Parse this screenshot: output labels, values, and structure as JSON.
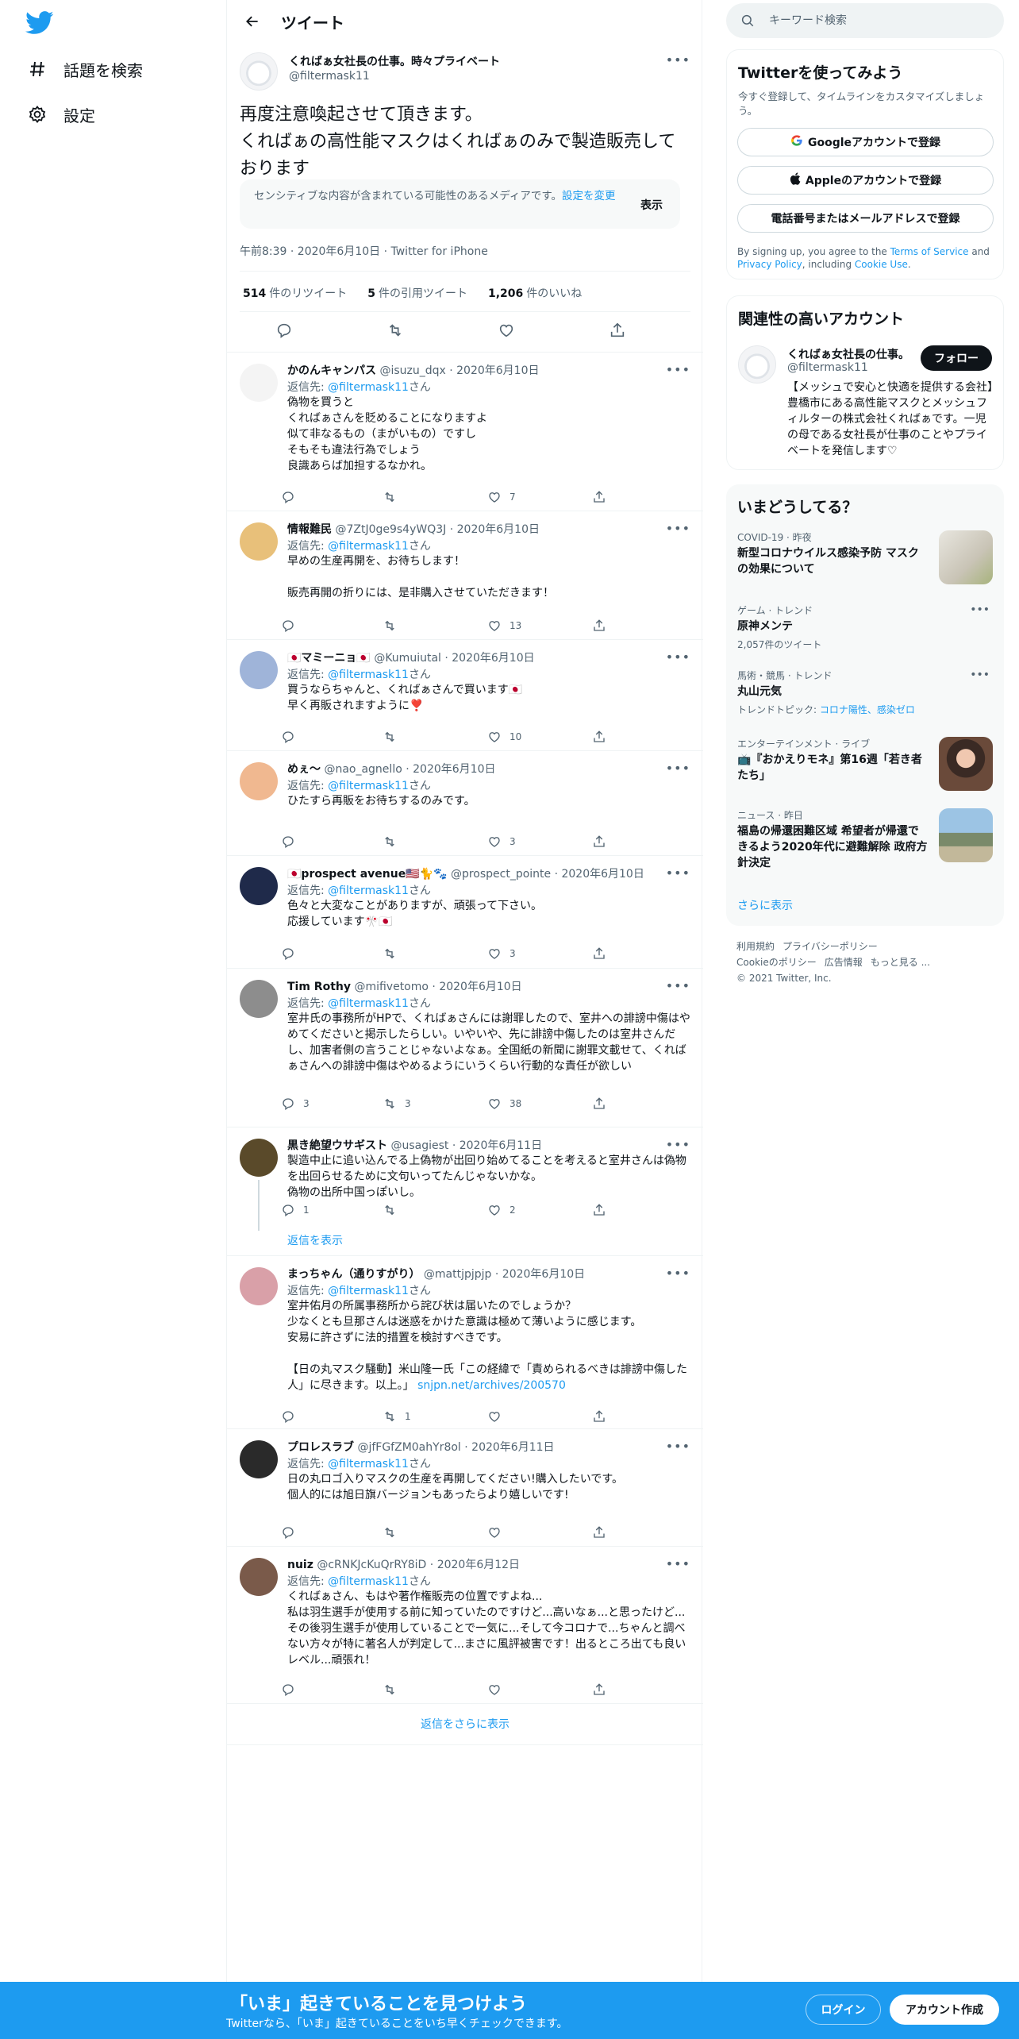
{
  "nav": {
    "explore": "話題を検索",
    "settings": "設定"
  },
  "header": {
    "title": "ツイート"
  },
  "tweet": {
    "name": "くればぁ女社長の仕事。時々プライベート",
    "handle": "@filtermask11",
    "text": "再度注意喚起させて頂きます。\nくればぁの高性能マスクはくればぁのみで製造販売しております",
    "sensitive_text": "センシティブな内容が含まれている可能性のあるメディアです。",
    "sensitive_link": "設定を変更",
    "sensitive_show": "表示",
    "meta": "午前8:39 · 2020年6月10日 · Twitter for iPhone",
    "retweets_count": "514",
    "retweets_label": "件のリツイート",
    "quotes_count": "5",
    "quotes_label": "件の引用ツイート",
    "likes_count": "1,206",
    "likes_label": "件のいいね"
  },
  "reply_prefix": "返信先: ",
  "reply_to": "@filtermask11",
  "reply_suffix": "さん",
  "replies": [
    {
      "name": "かのんキャンパス",
      "handle": "@isuzu_dqx",
      "date": "· 2020年6月10日",
      "text": "偽物を買うと\nくればぁさんを貶めることになりますよ\n似て非なるもの（まがいもの）ですし\nそもそも違法行為でしょう\n良識あらば加担するなかれ。",
      "replies": "",
      "retweets": "",
      "likes": "7",
      "color": "#f4f4f4"
    },
    {
      "name": "情報難民",
      "handle": "@7ZtJ0ge9s4yWQ3J",
      "date": "· 2020年6月10日",
      "text": "早めの生産再開を、お待ちします！\n\n販売再開の折りには、是非購入させていただきます！",
      "replies": "",
      "retweets": "",
      "likes": "13",
      "color": "#e8c07a"
    },
    {
      "name": "🇯🇵マミーニョ🇯🇵",
      "handle": "@Kumuiutal",
      "date": "· 2020年6月10日",
      "text": "買うならちゃんと、くればぁさんで買います🇯🇵\n早く再販されますように❣️",
      "replies": "",
      "retweets": "",
      "likes": "10",
      "color": "#9fb4d9"
    },
    {
      "name": "めぇ〜",
      "handle": "@nao_agnello",
      "date": "· 2020年6月10日",
      "text": "ひたすら再販をお待ちするのみです。",
      "replies": "",
      "retweets": "",
      "likes": "3",
      "color": "#f0b890"
    },
    {
      "name": "🇯🇵prospect avenue🇺🇸🐈🐾",
      "handle": "@prospect_pointe",
      "date": "· 2020年6月10日",
      "text": "色々と大変なことがありますが、頑張って下さい。\n応援しています🎌🇯🇵",
      "replies": "",
      "retweets": "",
      "likes": "3",
      "color": "#1f2a4a"
    },
    {
      "name": "Tim Rothy",
      "handle": "@mifivetomo",
      "date": "· 2020年6月10日",
      "text": "室井氏の事務所がHPで、くればぁさんには謝罪したので、室井への誹謗中傷はやめてくださいと掲示したらしい。いやいや、先に誹謗中傷したのは室井さんだし、加害者側の言うことじゃないよなぁ。全国紙の新聞に謝罪文載せて、くればぁさんへの誹謗中傷はやめるようにいうくらい行動的な責任が欲しい",
      "replies": "3",
      "retweets": "3",
      "likes": "38",
      "color": "#8d8d8d"
    },
    {
      "name": "黒き絶望ウサギスト",
      "handle": "@usagiest",
      "date": "· 2020年6月11日",
      "text": "製造中止に追い込んでる上偽物が出回り始めてることを考えると室井さんは偽物を出回らせるために文句いってたんじゃないかな。\n偽物の出所中国っぽいし。",
      "replies": "1",
      "retweets": "",
      "likes": "2",
      "color": "#5a4a2a"
    },
    {
      "name": "まっちゃん（通りすがり）",
      "handle": "@mattjpjpjp",
      "date": "· 2020年6月10日",
      "text": "室井佑月の所属事務所から詫び状は届いたのでしょうか？\n少なくとも旦那さんは迷惑をかけた意識は極めて薄いように感じます。\n安易に許さずに法的措置を検討すべきです。\n\n【日の丸マスク騒動】米山隆一氏「この経緯で「責められるべきは誹謗中傷した人」に尽きます。以上。」",
      "link": "snjpn.net/archives/200570",
      "replies": "",
      "retweets": "1",
      "likes": "",
      "color": "#d9a0a8"
    },
    {
      "name": "プロレスラブ",
      "handle": "@jfFGfZM0ahYr8ol",
      "date": "· 2020年6月11日",
      "text": "日の丸ロゴ入りマスクの生産を再開してください!購入したいです。\n個人的には旭日旗バージョンもあったらより嬉しいです!",
      "replies": "",
      "retweets": "",
      "likes": "",
      "color": "#2a2a2a"
    },
    {
      "name": "nuiz",
      "handle": "@cRNKJcKuQrRY8iD",
      "date": "· 2020年6月12日",
      "text": "くればぁさん、もはや著作権販売の位置ですよね...\n私は羽生選手が使用する前に知っていたのですけど...高いなぁ...と思ったけど...その後羽生選手が使用していることで一気に...そして今コロナで...ちゃんと調べない方々が特に著名人が判定して...まさに風評被害です！出るところ出ても良いレベル...頑張れ！",
      "replies": "",
      "retweets": "",
      "likes": "",
      "color": "#7a5a4a"
    }
  ],
  "show_replies": "返信を表示",
  "more_replies": "返信をさらに表示",
  "sidebar": {
    "search_placeholder": "キーワード検索",
    "signup": {
      "title": "Twitterを使ってみよう",
      "subtitle": "今すぐ登録して、タイムラインをカスタマイズしましょう。",
      "google": "Googleアカウントで登録",
      "apple": "Appleのアカウントで登録",
      "phone": "電話番号またはメールアドレスで登録",
      "legal_1": "By signing up, you agree to the ",
      "tos": "Terms of Service",
      "legal_2": " and ",
      "privacy": "Privacy Policy",
      "legal_3": ", including ",
      "cookie": "Cookie Use",
      "legal_4": "."
    },
    "related": {
      "title": "関連性の高いアカウント",
      "name": "くればぁ女社長の仕事。",
      "handle": "@filtermask11",
      "follow": "フォロー",
      "bio": "【メッシュで安心と快適を提供する会社】豊橋市にある高性能マスクとメッシュフィルターの株式会社くればぁです。一児の母である女社長が仕事のことやプライベートを発信します♡"
    },
    "trends": {
      "title": "いまどうしてる？",
      "items": [
        {
          "ctx": "COVID-19 · 昨夜",
          "title": "新型コロナウイルス感染予防 マスクの効果について",
          "sub": ""
        },
        {
          "ctx": "ゲーム · トレンド",
          "title": "原神メンテ",
          "sub": "2,057件のツイート"
        },
        {
          "ctx": "馬術・競馬 · トレンド",
          "title": "丸山元気",
          "sub_prefix": "トレンドトピック: ",
          "sub_links": "コロナ陽性、感染ゼロ"
        },
        {
          "ctx": "エンターテインメント · ライブ",
          "title": "📺『おかえりモネ』第16週「若き者たち」",
          "sub": ""
        },
        {
          "ctx": "ニュース · 昨日",
          "title": "福島の帰還困難区域 希望者が帰還できるよう2020年代に避難解除 政府方針決定",
          "sub": ""
        }
      ],
      "show_more": "さらに表示"
    },
    "footer": {
      "terms": "利用規約",
      "privacy": "プライバシーポリシー",
      "cookie": "Cookieのポリシー",
      "ads": "広告情報",
      "more": "もっと見る ...",
      "copyright": "© 2021 Twitter, Inc."
    }
  },
  "bottombar": {
    "title": "「いま」起きていることを見つけよう",
    "subtitle": "Twitterなら、「いま」起きていることをいち早くチェックできます。",
    "login": "ログイン",
    "signup": "アカウント作成"
  },
  "colors": {
    "accent": "#1d9bf0",
    "text": "#0f1419",
    "muted": "#536471"
  }
}
